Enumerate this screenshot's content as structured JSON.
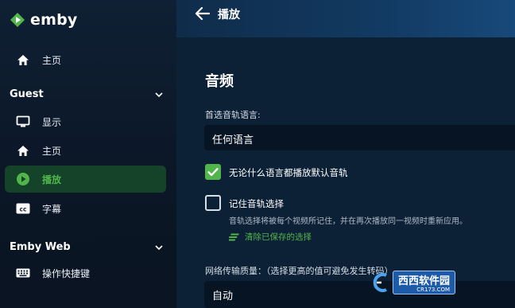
{
  "brand": {
    "name": "emby"
  },
  "sidebar": {
    "home": {
      "label": "主页"
    },
    "sections": [
      {
        "title": "Guest",
        "items": [
          {
            "label": "显示",
            "icon": "monitor-icon"
          },
          {
            "label": "主页",
            "icon": "home-icon"
          },
          {
            "label": "播放",
            "icon": "play-circle-icon",
            "active": true
          },
          {
            "label": "字幕",
            "icon": "cc-icon"
          }
        ]
      },
      {
        "title": "Emby Web",
        "items": [
          {
            "label": "操作快捷键",
            "icon": "keyboard-icon"
          }
        ]
      }
    ]
  },
  "header": {
    "title": "播放"
  },
  "audio": {
    "section_title": "音频",
    "pref_lang_label": "首选音轨语言:",
    "pref_lang_value": "任何语言",
    "play_default": {
      "label": "无论什么语言都播放默认音轨",
      "checked": true
    },
    "remember": {
      "label": "记住音轨选择",
      "checked": false,
      "help": "音轨选择将被每个视频所记住，并在再次播放同一视频时重新应用。",
      "clear_label": "清除已保存的选择"
    },
    "network_quality_label": "网络传输质量：（选择更高的值可避免发生转码）",
    "network_quality_value": "自动"
  },
  "watermark": {
    "text": "西西软件园",
    "sub": "CR173.COM"
  },
  "colors": {
    "accent": "#52b54b",
    "sidebar_bg": "#0f2034",
    "topbar": "#123a62"
  }
}
